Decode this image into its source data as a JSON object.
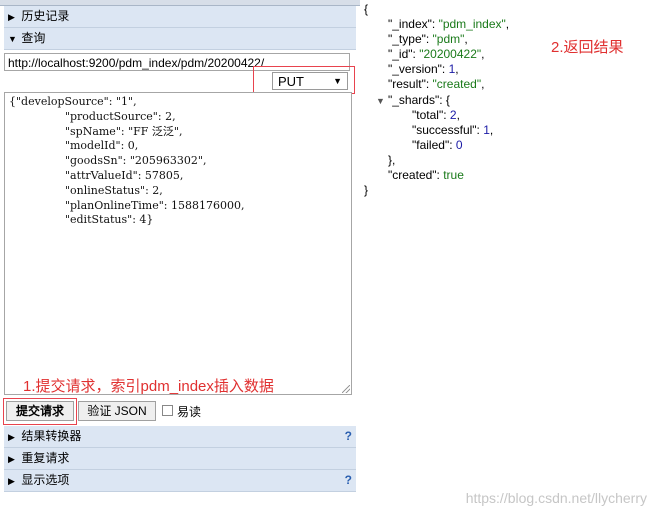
{
  "left_panel": {
    "sections": [
      {
        "label": "历史记录",
        "expanded": false
      },
      {
        "label": "查询",
        "expanded": true
      }
    ],
    "url": "http://localhost:9200/pdm_index/pdm/20200422/",
    "method": "PUT",
    "request_body": "{\"developSource\": \"1\",\n                \"productSource\": 2,\n                \"spName\": \"FF 泛泛\",\n                \"modelId\": 0,\n                \"goodsSn\": \"205963302\",\n                \"attrValueId\": 57805,\n                \"onlineStatus\": 2,\n                \"planOnlineTime\": 1588176000,\n                \"editStatus\": 4}",
    "annotation_1": "1.提交请求，索引pdm_index插入数据",
    "submit_label": "提交请求",
    "validate_label": "验证 JSON",
    "readable_label": "易读",
    "bottom_sections": [
      {
        "label": "结果转换器",
        "help": "?"
      },
      {
        "label": "重复请求",
        "help": ""
      },
      {
        "label": "显示选项",
        "help": "?"
      }
    ]
  },
  "result": {
    "annotation_2": "2.返回结果",
    "lines": [
      {
        "indent": 0,
        "text": "{"
      },
      {
        "indent": 1,
        "key": "\"_index\"",
        "value": "\"pdm_index\"",
        "type": "s"
      },
      {
        "indent": 1,
        "key": "\"_type\"",
        "value": "\"pdm\"",
        "type": "s"
      },
      {
        "indent": 1,
        "key": "\"_id\"",
        "value": "\"20200422\"",
        "type": "s"
      },
      {
        "indent": 1,
        "key": "\"_version\"",
        "value": "1",
        "type": "n"
      },
      {
        "indent": 1,
        "key": "\"result\"",
        "value": "\"created\"",
        "type": "s"
      },
      {
        "indent": 1,
        "key": "\"_shards\"",
        "value": "{",
        "type": "open"
      },
      {
        "indent": 2,
        "key": "\"total\"",
        "value": "2",
        "type": "n"
      },
      {
        "indent": 2,
        "key": "\"successful\"",
        "value": "1",
        "type": "n"
      },
      {
        "indent": 2,
        "key": "\"failed\"",
        "value": "0",
        "type": "n",
        "last": true
      },
      {
        "indent": 1,
        "text": "},"
      },
      {
        "indent": 1,
        "key": "\"created\"",
        "value": "true",
        "type": "b",
        "last": true
      },
      {
        "indent": 0,
        "text": "}"
      }
    ]
  },
  "watermark": "https://blog.csdn.net/llycherry",
  "colors": {
    "annotation": "#e03030",
    "panel_header": "#dce6f3",
    "string": "#1a7a1a",
    "number": "#1a1aa6"
  }
}
